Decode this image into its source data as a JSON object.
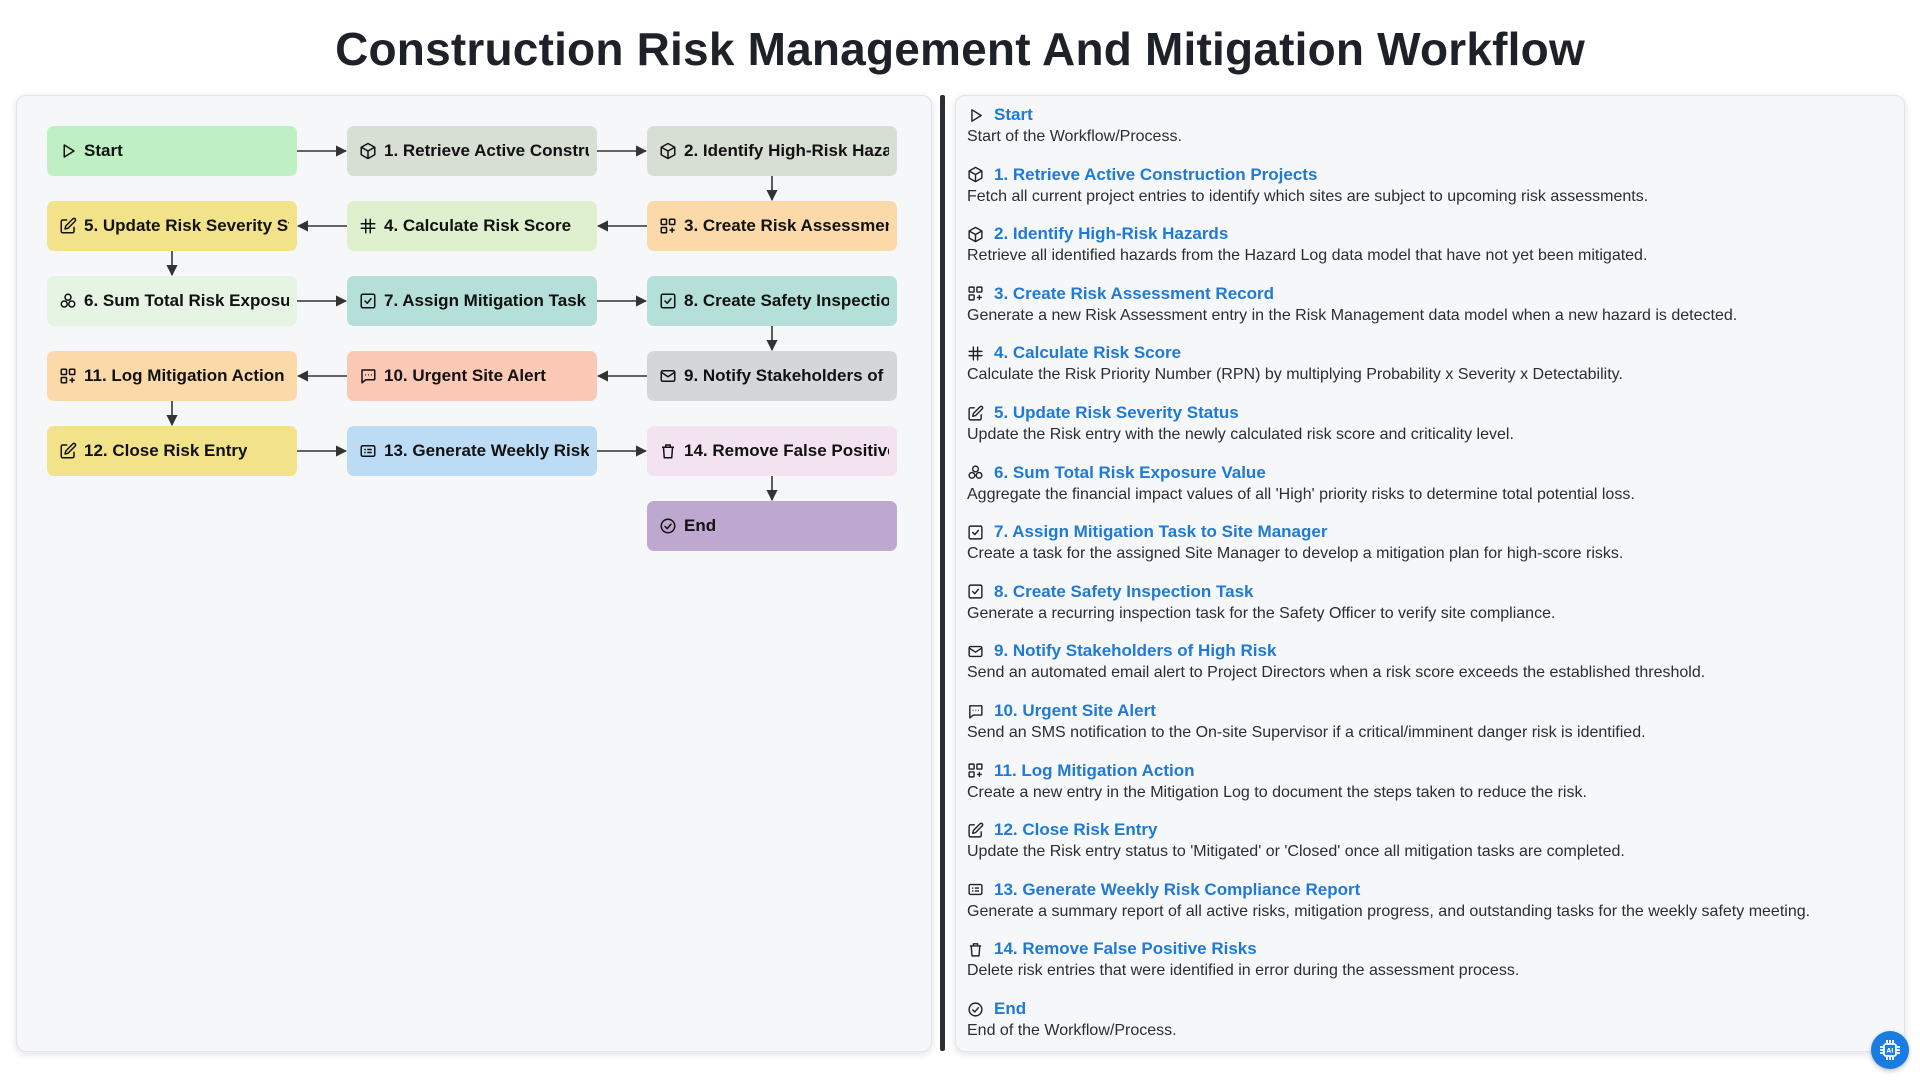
{
  "title": "Construction Risk Management And Mitigation Workflow",
  "nodes": [
    {
      "label": "Start",
      "icon": "play-icon",
      "color": "#bff0c4"
    },
    {
      "label": "1. Retrieve Active Construction Projects",
      "icon": "cube-icon",
      "color": "#d7dfd4"
    },
    {
      "label": "2. Identify High-Risk Hazards",
      "icon": "cube-icon",
      "color": "#d7dfd4"
    },
    {
      "label": "3. Create Risk Assessment Record",
      "icon": "grid-plus-icon",
      "color": "#fcd9a8"
    },
    {
      "label": "4. Calculate Risk Score",
      "icon": "hash-icon",
      "color": "#dff0cf"
    },
    {
      "label": "5. Update Risk Severity Status",
      "icon": "edit-icon",
      "color": "#f2e38a"
    },
    {
      "label": "6. Sum Total Risk Exposure Value",
      "icon": "aggregate-icon",
      "color": "#e6f4e3"
    },
    {
      "label": "7. Assign Mitigation Task to Site Manager",
      "icon": "checkbox-icon",
      "color": "#b4e0d9"
    },
    {
      "label": "8. Create Safety Inspection Task",
      "icon": "checkbox-icon",
      "color": "#b4e0d9"
    },
    {
      "label": "9. Notify Stakeholders of High Risk",
      "icon": "mail-icon",
      "color": "#d4d6d9"
    },
    {
      "label": "10. Urgent Site Alert",
      "icon": "sms-icon",
      "color": "#fbc9b6"
    },
    {
      "label": "11. Log Mitigation Action",
      "icon": "grid-plus-icon",
      "color": "#fcd9a8"
    },
    {
      "label": "12. Close Risk Entry",
      "icon": "edit-icon",
      "color": "#f2e38a"
    },
    {
      "label": "13. Generate Weekly Risk Compliance Report",
      "icon": "report-icon",
      "color": "#bcdcf6"
    },
    {
      "label": "14. Remove False Positive Risks",
      "icon": "trash-icon",
      "color": "#f3e3f1"
    },
    {
      "label": "End",
      "icon": "check-circle-icon",
      "color": "#bea8d0"
    }
  ],
  "descriptions": [
    {
      "title": "Start",
      "text": "Start of the Workflow/Process."
    },
    {
      "title": "1. Retrieve Active Construction Projects",
      "text": "Fetch all current project entries to identify which sites are subject to upcoming risk assessments."
    },
    {
      "title": "2. Identify High-Risk Hazards",
      "text": "Retrieve all identified hazards from the Hazard Log data model that have not yet been mitigated."
    },
    {
      "title": "3. Create Risk Assessment Record",
      "text": "Generate a new Risk Assessment entry in the Risk Management data model when a new hazard is detected."
    },
    {
      "title": "4. Calculate Risk Score",
      "text": "Calculate the Risk Priority Number (RPN) by multiplying Probability x Severity x Detectability."
    },
    {
      "title": "5. Update Risk Severity Status",
      "text": "Update the Risk entry with the newly calculated risk score and criticality level."
    },
    {
      "title": "6. Sum Total Risk Exposure Value",
      "text": "Aggregate the financial impact values of all 'High' priority risks to determine total potential loss."
    },
    {
      "title": "7. Assign Mitigation Task to Site Manager",
      "text": "Create a task for the assigned Site Manager to develop a mitigation plan for high-score risks."
    },
    {
      "title": "8. Create Safety Inspection Task",
      "text": "Generate a recurring inspection task for the Safety Officer to verify site compliance."
    },
    {
      "title": "9. Notify Stakeholders of High Risk",
      "text": "Send an automated email alert to Project Directors when a risk score exceeds the established threshold."
    },
    {
      "title": "10. Urgent Site Alert",
      "text": "Send an SMS notification to the On-site Supervisor if a critical/imminent danger risk is identified."
    },
    {
      "title": "11. Log Mitigation Action",
      "text": "Create a new entry in the Mitigation Log to document the steps taken to reduce the risk."
    },
    {
      "title": "12. Close Risk Entry",
      "text": "Update the Risk entry status to 'Mitigated' or 'Closed' once all mitigation tasks are completed."
    },
    {
      "title": "13. Generate Weekly Risk Compliance Report",
      "text": "Generate a summary report of all active risks, mitigation progress, and outstanding tasks for the weekly safety meeting."
    },
    {
      "title": "14. Remove False Positive Risks",
      "text": "Delete risk entries that were identified in error during the assessment process."
    },
    {
      "title": "End",
      "text": "End of the Workflow/Process."
    }
  ],
  "accent_color": "#1f7ad6"
}
